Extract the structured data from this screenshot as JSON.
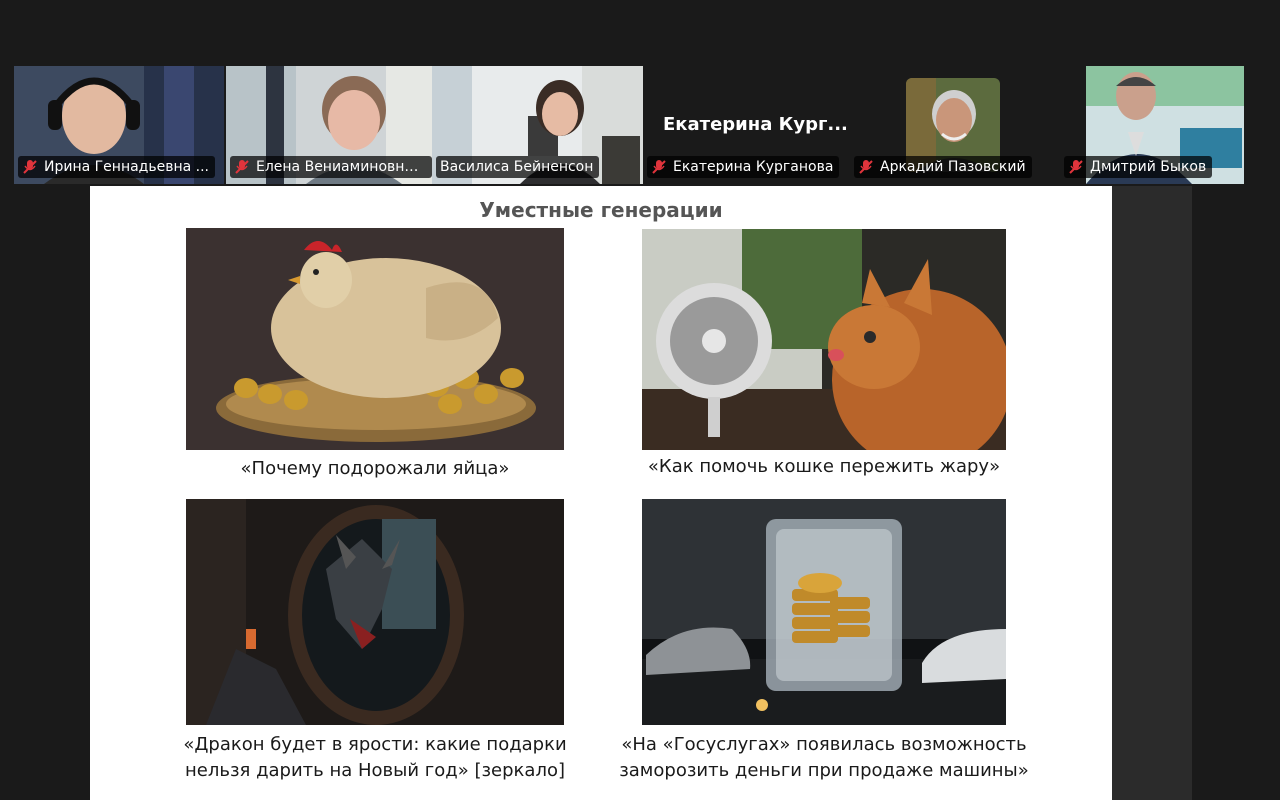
{
  "participants": [
    {
      "name": "Ирина Геннадьевна ...",
      "muted": true
    },
    {
      "name": "Елена Вениаминовна...",
      "muted": true
    },
    {
      "name": "Василиса Бейненсон",
      "muted": false,
      "active_speaker": true
    },
    {
      "name": "Екатерина Курганова",
      "muted": true,
      "display_name": "Екатерина  Кург..."
    },
    {
      "name": "Аркадий Пазовский",
      "muted": true
    },
    {
      "name": "Дмитрий Быков",
      "muted": true
    }
  ],
  "slide": {
    "title": "Уместные генерации",
    "items": [
      {
        "caption": "«Почему подорожали яйца»",
        "image": "golden-hen-eggs"
      },
      {
        "caption": "«Как помочь кошке пережить жару»",
        "image": "cat-and-fan"
      },
      {
        "caption_line1": "«Дракон будет в ярости: какие подарки",
        "caption_line2": "нельзя дарить на Новый год» [зеркало]",
        "image": "dragon-mirror"
      },
      {
        "caption_line1": "«На «Госуслугах» появилась возможность",
        "caption_line2": "заморозить деньги при продаже машины»",
        "image": "frozen-coins-cars"
      }
    ]
  },
  "colors": {
    "active_speaker": "#2ed47a",
    "muted_icon": "#e0343c",
    "background": "#1a1a1a"
  }
}
